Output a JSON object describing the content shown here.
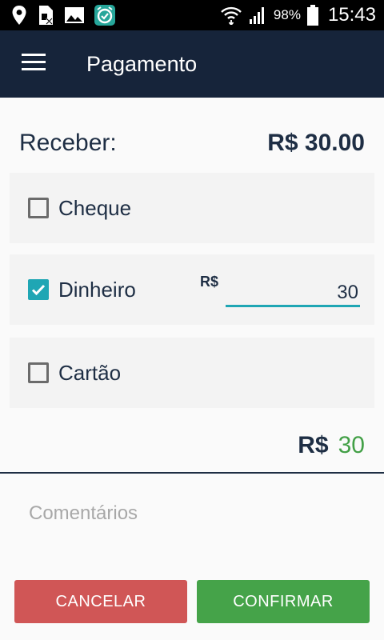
{
  "status_bar": {
    "battery_percent": "98%",
    "time": "15:43",
    "icons": [
      "location-icon",
      "sim-card-icon",
      "image-icon",
      "app-alarm-icon",
      "wifi-icon",
      "signal-icon",
      "battery-icon"
    ]
  },
  "app_bar": {
    "title": "Pagamento",
    "menu_icon": "hamburger-menu-icon"
  },
  "summary": {
    "receive_label": "Receber:",
    "receive_amount": "R$ 30.00"
  },
  "payment_methods": [
    {
      "label": "Cheque",
      "checked": false
    },
    {
      "label": "Dinheiro",
      "checked": true,
      "currency_prefix": "R$",
      "amount_value": "30"
    },
    {
      "label": "Cartão",
      "checked": false
    }
  ],
  "total": {
    "currency": "R$",
    "value": "30"
  },
  "comments": {
    "placeholder": "Comentários",
    "value": ""
  },
  "actions": {
    "cancel_label": "CANCELAR",
    "confirm_label": "CONFIRMAR"
  },
  "colors": {
    "app_bar": "#16243a",
    "accent": "#1fa6b4",
    "cancel": "#d05656",
    "confirm": "#45a349",
    "total_value": "#43a047"
  }
}
